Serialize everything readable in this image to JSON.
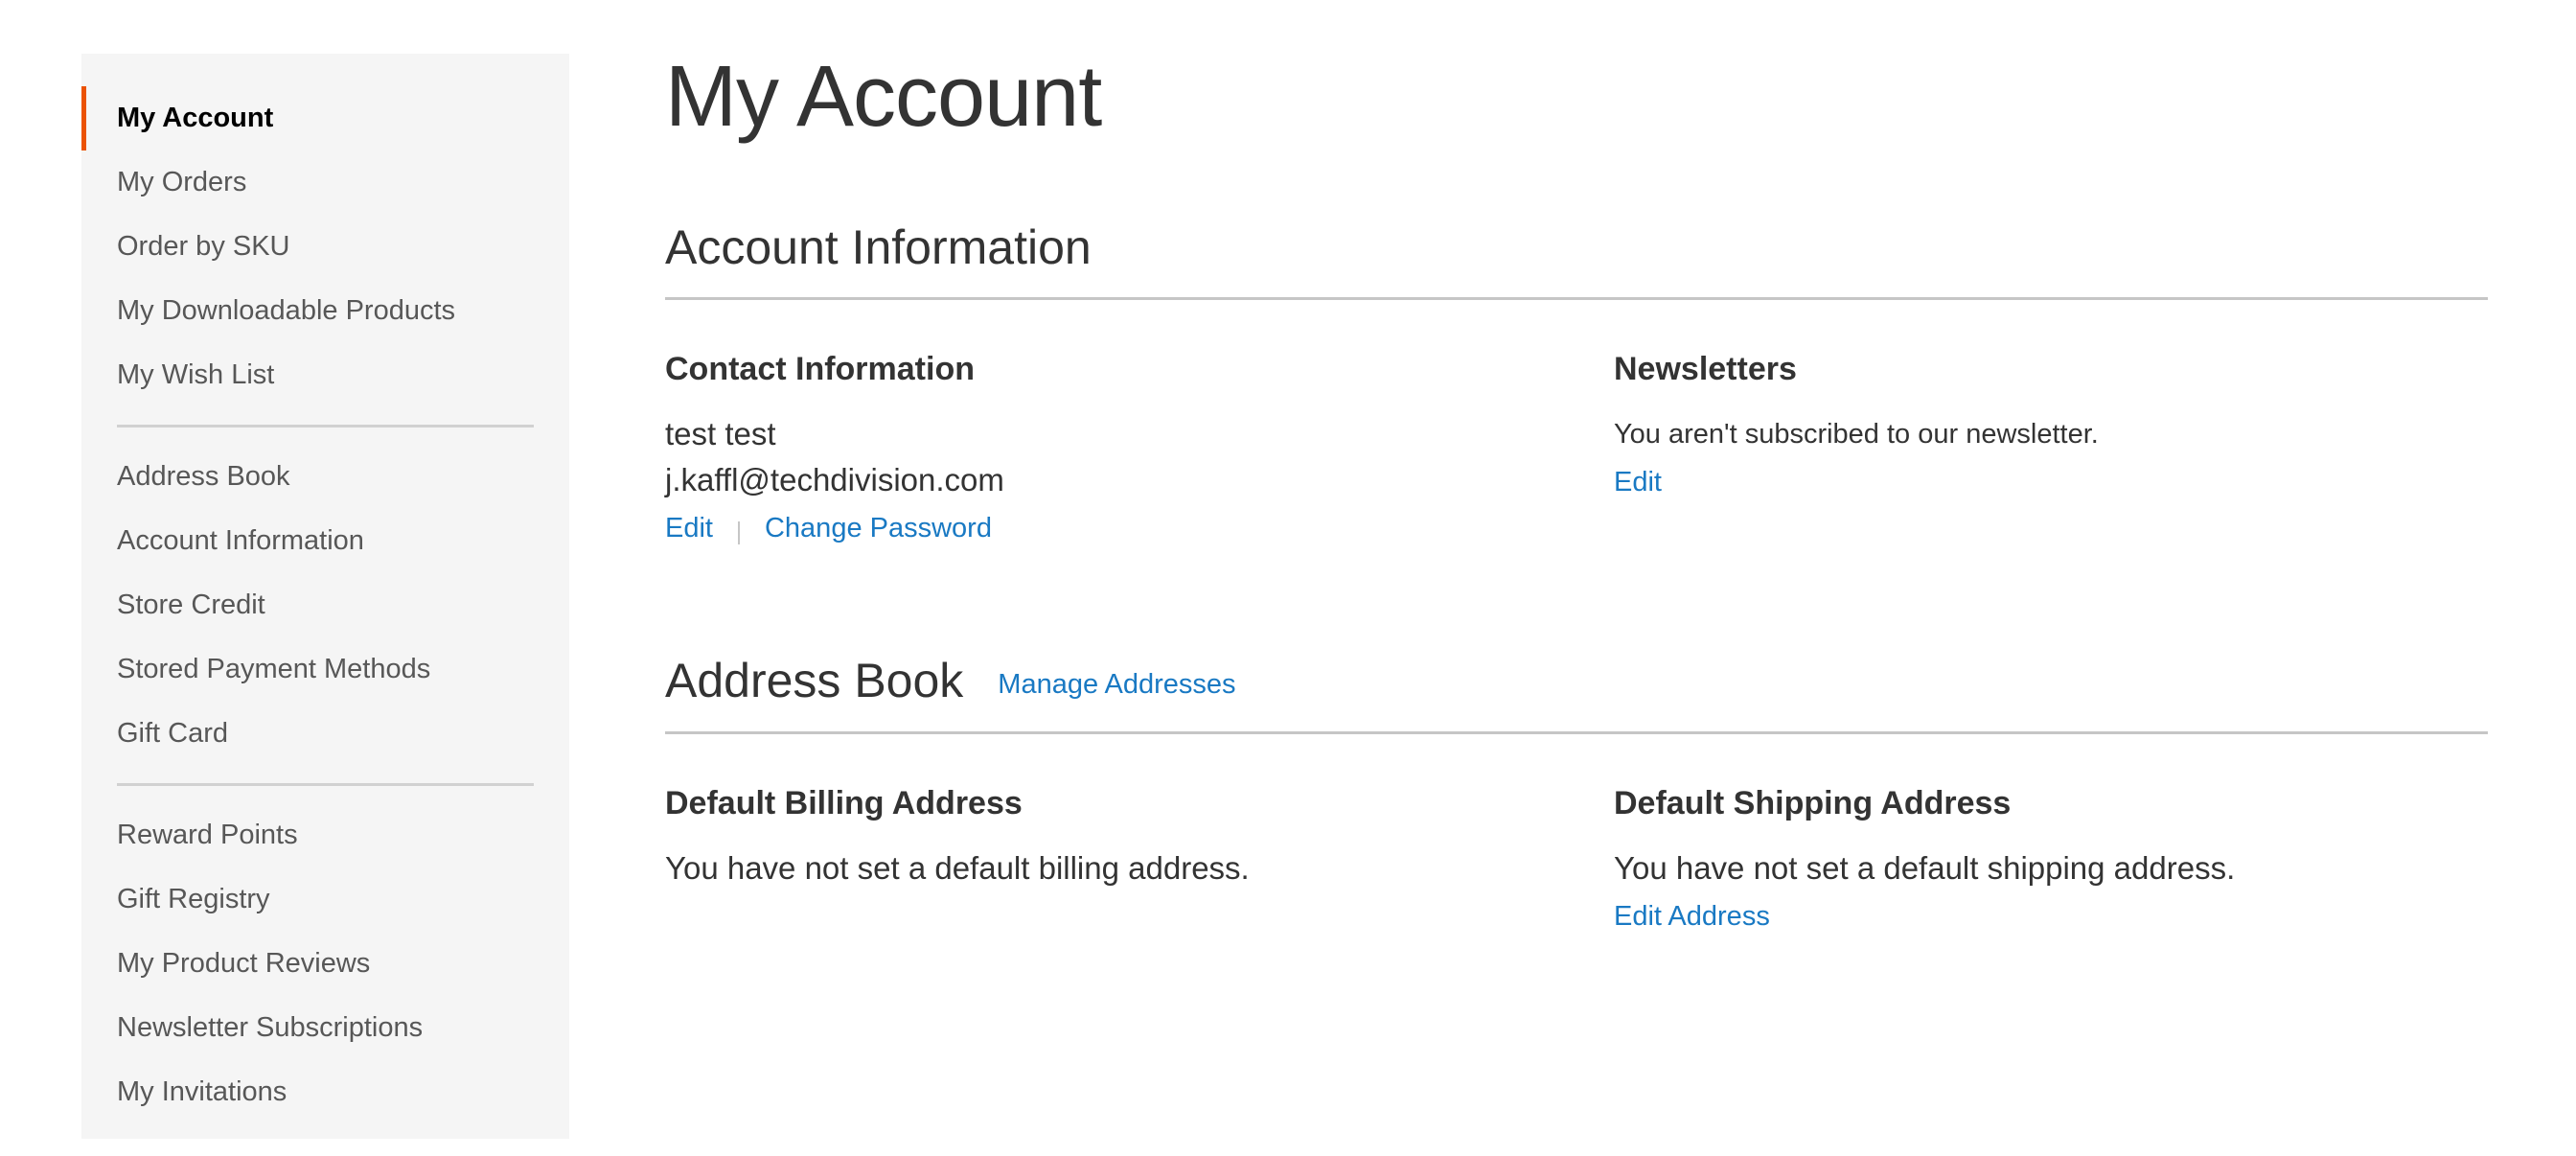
{
  "sidebar": {
    "groups": [
      [
        {
          "label": "My Account",
          "active": true
        },
        {
          "label": "My Orders"
        },
        {
          "label": "Order by SKU"
        },
        {
          "label": "My Downloadable Products"
        },
        {
          "label": "My Wish List"
        }
      ],
      [
        {
          "label": "Address Book"
        },
        {
          "label": "Account Information"
        },
        {
          "label": "Store Credit"
        },
        {
          "label": "Stored Payment Methods"
        },
        {
          "label": "Gift Card"
        }
      ],
      [
        {
          "label": "Reward Points"
        },
        {
          "label": "Gift Registry"
        },
        {
          "label": "My Product Reviews"
        },
        {
          "label": "Newsletter Subscriptions"
        },
        {
          "label": "My Invitations"
        }
      ]
    ]
  },
  "main": {
    "page_title": "My Account",
    "account_info": {
      "title": "Account Information",
      "contact": {
        "title": "Contact Information",
        "name": "test test",
        "email": "j.kaffl@techdivision.com",
        "edit_label": "Edit",
        "change_password_label": "Change Password"
      },
      "newsletters": {
        "title": "Newsletters",
        "status": "You aren't subscribed to our newsletter.",
        "edit_label": "Edit"
      }
    },
    "address_book": {
      "title": "Address Book",
      "manage_label": "Manage Addresses",
      "billing": {
        "title": "Default Billing Address",
        "text": "You have not set a default billing address."
      },
      "shipping": {
        "title": "Default Shipping Address",
        "text": "You have not set a default shipping address.",
        "edit_label": "Edit Address"
      }
    }
  },
  "colors": {
    "accent": "#eb5202",
    "link": "#1979c3",
    "sidebar_bg": "#f5f5f5",
    "text": "#333333"
  }
}
